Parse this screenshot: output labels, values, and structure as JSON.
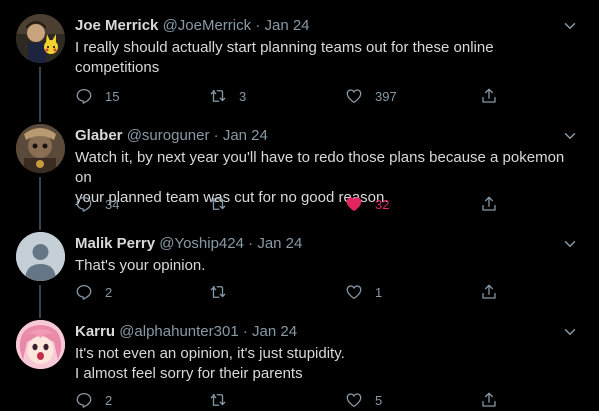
{
  "tweets": [
    {
      "name": "Joe Merrick",
      "handle": "@JoeMerrick",
      "separator": "·",
      "date": "Jan 24",
      "lines": [
        "I really should actually start planning teams out for these online",
        "competitions"
      ],
      "replies": "15",
      "retweets": "3",
      "likes": "397",
      "liked": false,
      "avatar_icon": "joe-merrick-avatar"
    },
    {
      "name": "Glaber",
      "handle": "@suroguner",
      "separator": "·",
      "date": "Jan 24",
      "lines": [
        "Watch it, by next year you'll have to redo those plans because a pokemon on",
        "your planned team was cut for no good reason."
      ],
      "replies": "34",
      "retweets": "",
      "likes": "32",
      "liked": true,
      "avatar_icon": "glaber-avatar"
    },
    {
      "name": "Malik Perry",
      "handle": "@Yoship424",
      "separator": "·",
      "date": "Jan 24",
      "lines": [
        "That's your opinion."
      ],
      "replies": "2",
      "retweets": "",
      "likes": "1",
      "liked": false,
      "avatar_icon": "default-user-avatar"
    },
    {
      "name": "Karru",
      "handle": "@alphahunter301",
      "separator": "·",
      "date": "Jan 24",
      "lines": [
        "It's not even an opinion, it's just stupidity.",
        "I almost feel sorry for their parents"
      ],
      "replies": "2",
      "retweets": "",
      "likes": "5",
      "liked": false,
      "avatar_icon": "karru-anime-avatar"
    }
  ],
  "colors": {
    "background": "#000000",
    "text": "#d9d9d9",
    "secondary": "#8899a6",
    "like_active": "#e0245e",
    "thread_line": "#38444d"
  },
  "icons": {
    "reply": "reply-icon",
    "retweet": "retweet-icon",
    "like": "heart-icon",
    "share": "share-icon",
    "more": "chevron-down-icon"
  }
}
